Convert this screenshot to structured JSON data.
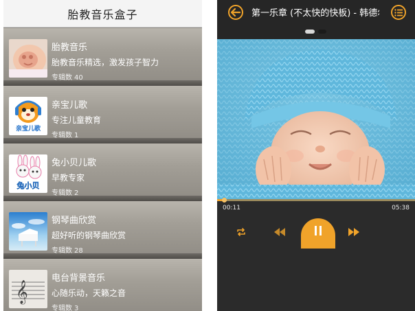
{
  "left": {
    "title": "胎教音乐盒子",
    "items": [
      {
        "title": "胎教音乐",
        "subtitle": "胎教音乐精选，激发孩子智力",
        "count_label": "专辑数",
        "count": "40",
        "thumb": "pregnant-belly"
      },
      {
        "title": "亲宝儿歌",
        "subtitle": "专注儿童教育",
        "count_label": "专辑数",
        "count": "1",
        "thumb": "qinbao-logo",
        "thumb_text": "亲宝儿歌"
      },
      {
        "title": "兔小贝儿歌",
        "subtitle": "早教专家",
        "count_label": "专辑数",
        "count": "2",
        "thumb": "rabbits-logo",
        "thumb_text": "兔小贝"
      },
      {
        "title": "钢琴曲欣赏",
        "subtitle": "超好听的钢琴曲欣赏",
        "count_label": "专辑数",
        "count": "28",
        "thumb": "piano"
      },
      {
        "title": "电台背景音乐",
        "subtitle": "心随乐动，天籁之音",
        "count_label": "专辑数",
        "count": "3",
        "thumb": "music-staff"
      }
    ]
  },
  "right": {
    "song_title": "第一乐章 (不太快的快板) - 韩德尔",
    "elapsed": "00:11",
    "duration": "05:38",
    "progress": 0.033,
    "page_dots": 2,
    "active_dot": 0,
    "colors": {
      "accent": "#f0a32a",
      "bg": "#2b2b2b"
    },
    "icons": {
      "back": "back-arrow-icon",
      "list": "playlist-icon",
      "repeat": "repeat-icon",
      "prev": "rewind-icon",
      "play": "pause-icon",
      "next": "fast-forward-icon"
    }
  }
}
